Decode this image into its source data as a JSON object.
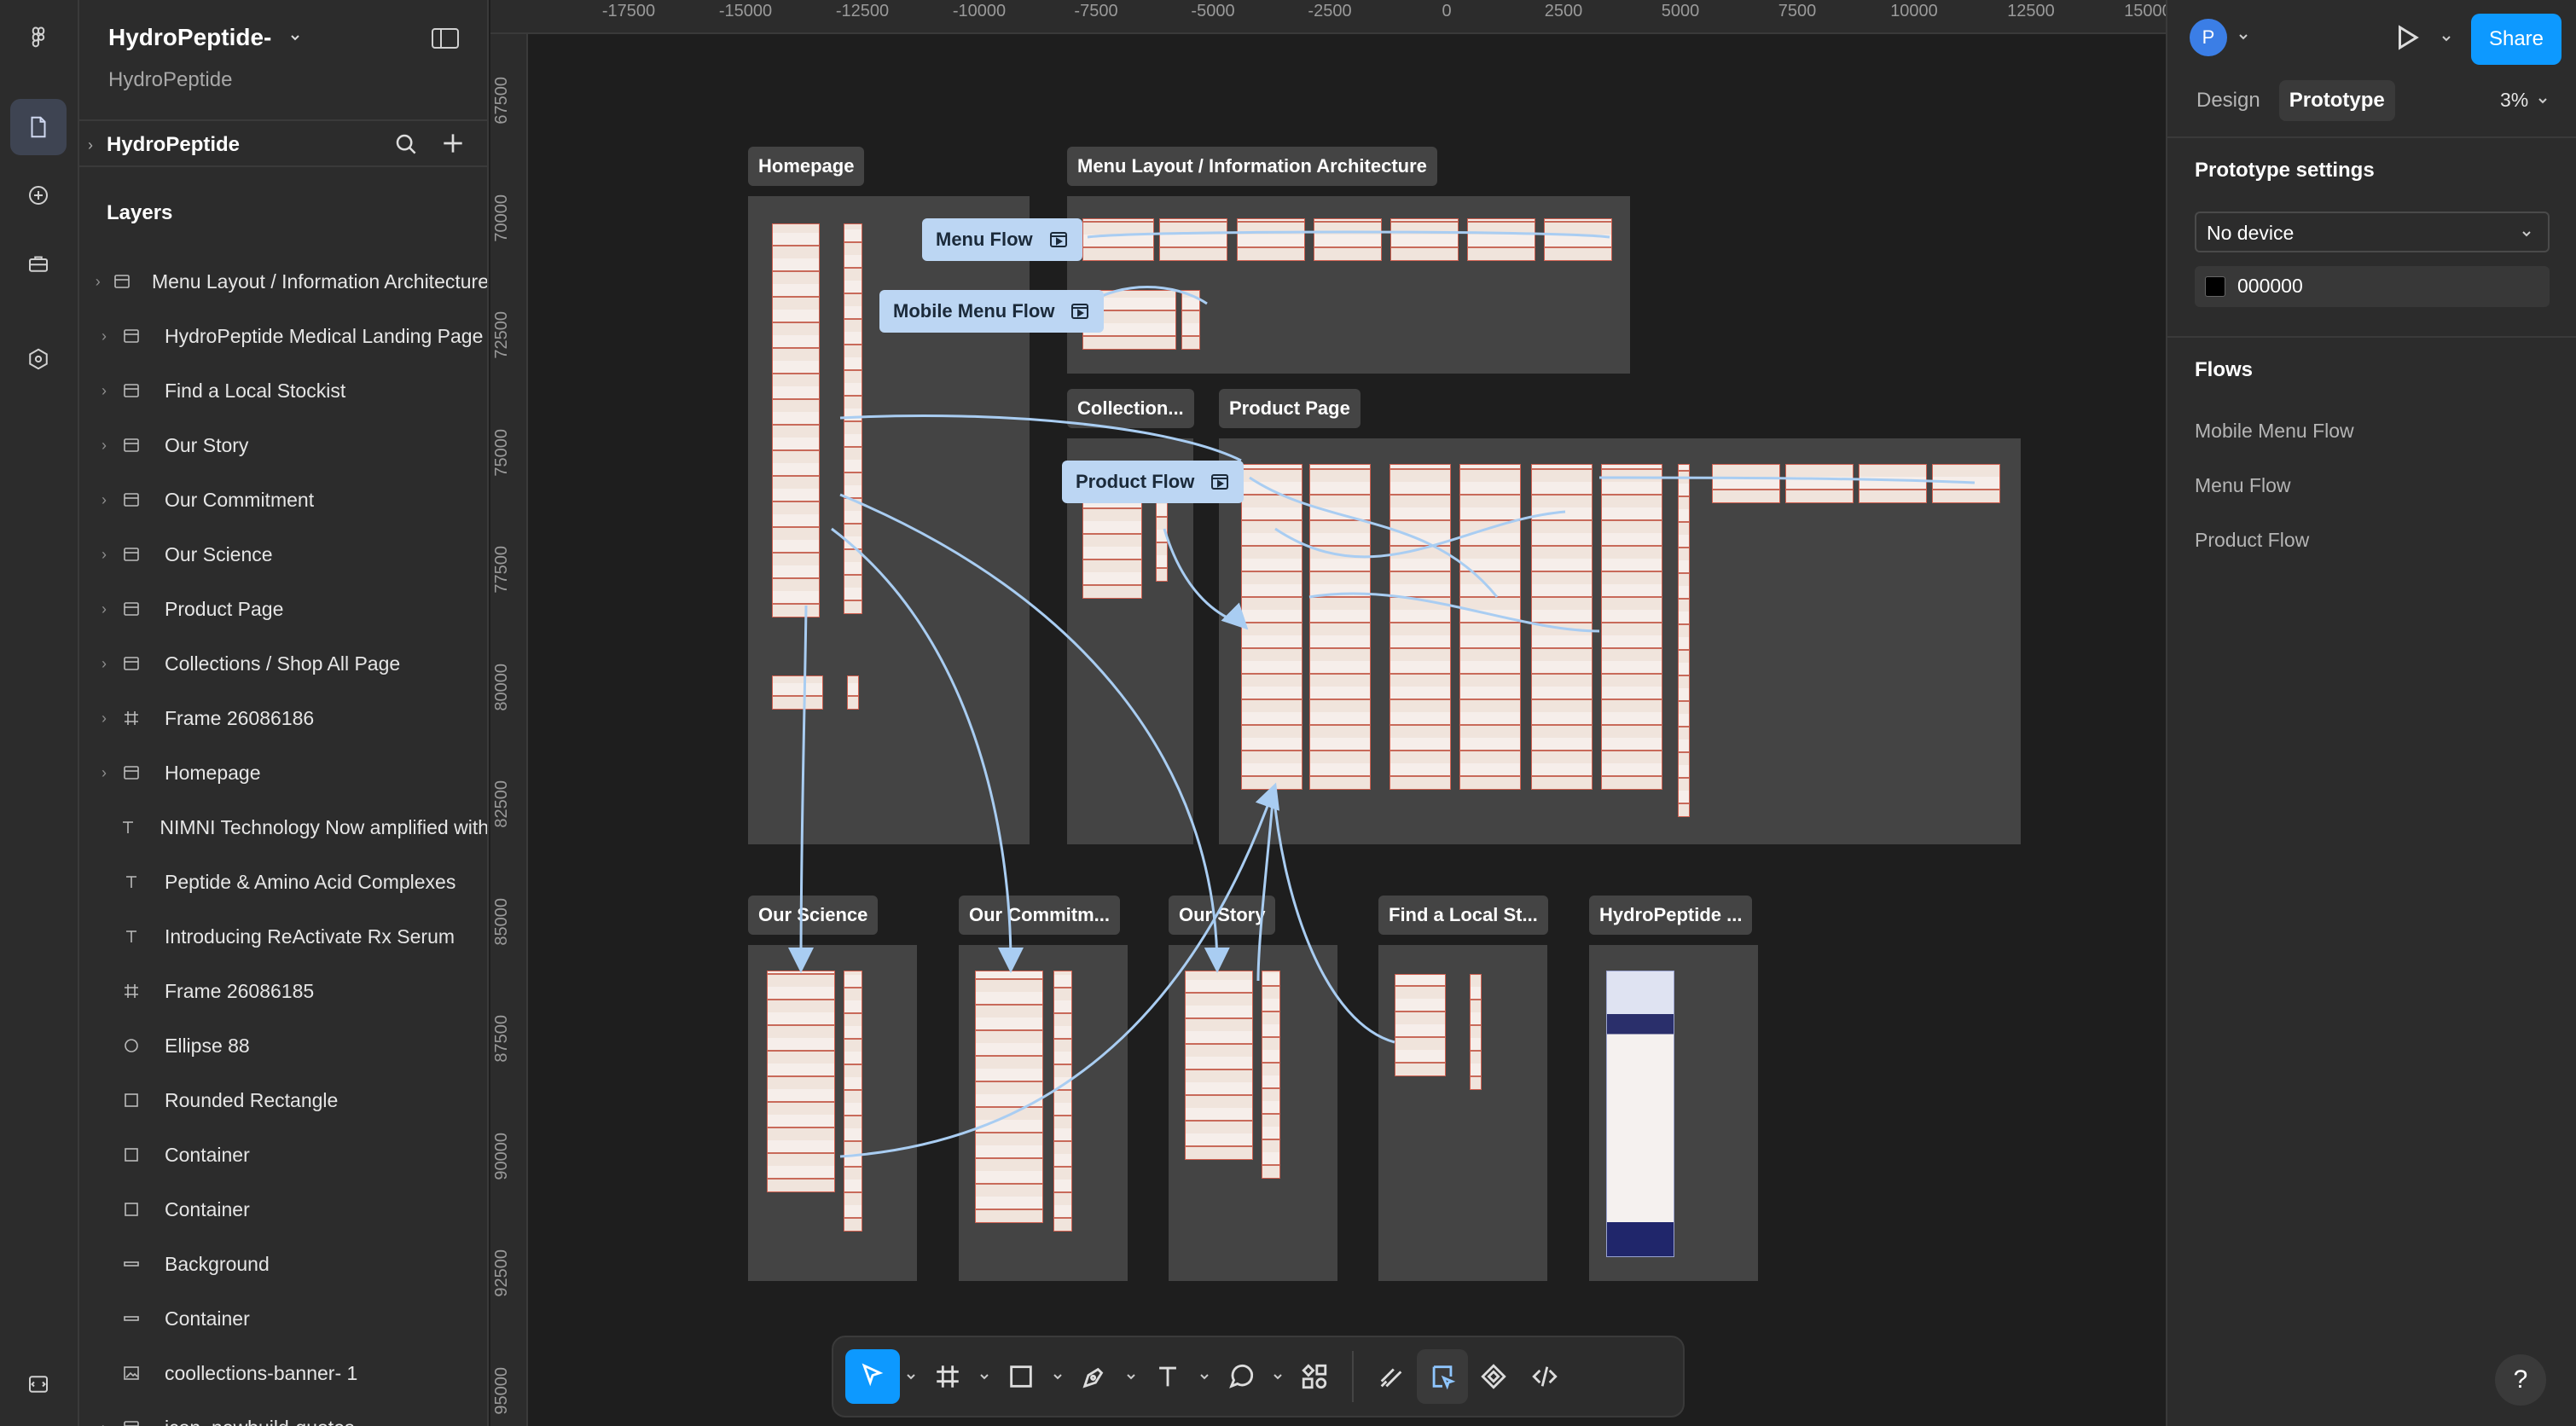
{
  "file": {
    "title": "HydroPeptide-",
    "subtitle": "HydroPeptide"
  },
  "pages": {
    "current": "HydroPeptide"
  },
  "layers": {
    "title": "Layers",
    "items": [
      {
        "label": "Menu Layout / Information Architecture",
        "kind": "section",
        "expandable": true
      },
      {
        "label": "HydroPeptide Medical Landing Page",
        "kind": "section",
        "expandable": true
      },
      {
        "label": "Find a Local Stockist",
        "kind": "section",
        "expandable": true
      },
      {
        "label": "Our Story",
        "kind": "section",
        "expandable": true
      },
      {
        "label": "Our Commitment",
        "kind": "section",
        "expandable": true
      },
      {
        "label": "Our Science",
        "kind": "section",
        "expandable": true
      },
      {
        "label": "Product Page",
        "kind": "section",
        "expandable": true
      },
      {
        "label": "Collections / Shop All Page",
        "kind": "section",
        "expandable": true
      },
      {
        "label": "Frame 26086186",
        "kind": "frame",
        "expandable": true
      },
      {
        "label": "Homepage",
        "kind": "section",
        "expandable": true
      },
      {
        "label": "NIMNI Technology Now amplified with",
        "kind": "text",
        "expandable": false
      },
      {
        "label": "Peptide & Amino Acid Complexes",
        "kind": "text",
        "expandable": false
      },
      {
        "label": "Introducing ReActivate Rx Serum",
        "kind": "text",
        "expandable": false
      },
      {
        "label": "Frame 26086185",
        "kind": "frame",
        "expandable": false
      },
      {
        "label": "Ellipse 88",
        "kind": "ellipse",
        "expandable": false
      },
      {
        "label": "Rounded Rectangle",
        "kind": "rect",
        "expandable": false
      },
      {
        "label": "Container",
        "kind": "rect",
        "expandable": false
      },
      {
        "label": "Container",
        "kind": "rect",
        "expandable": false
      },
      {
        "label": "Background",
        "kind": "line",
        "expandable": false
      },
      {
        "label": "Container",
        "kind": "line",
        "expandable": false
      },
      {
        "label": "coollections-banner- 1",
        "kind": "image",
        "expandable": false
      },
      {
        "label": "icon_newbuild-quotes",
        "kind": "section",
        "expandable": true
      }
    ]
  },
  "canvas": {
    "ruler_x": [
      "-17500",
      "-15000",
      "-12500",
      "-10000",
      "-7500",
      "-5000",
      "-2500",
      "0",
      "2500",
      "5000",
      "7500",
      "10000",
      "12500",
      "15000"
    ],
    "ruler_y": [
      "67500",
      "70000",
      "72500",
      "75000",
      "77500",
      "80000",
      "82500",
      "85000",
      "87500",
      "90000",
      "92500",
      "95000"
    ],
    "sections": {
      "homepage": "Homepage",
      "menu_layout": "Menu Layout / Information Architecture",
      "collections": "Collection...",
      "product_page": "Product Page",
      "our_science": "Our Science",
      "our_commitment": "Our Commitm...",
      "our_story": "Our Story",
      "find_stockist": "Find a Local St...",
      "hydropeptide": "HydroPeptide ..."
    },
    "flows": {
      "menu": "Menu Flow",
      "mobile_menu": "Mobile Menu Flow",
      "product": "Product Flow"
    }
  },
  "right_panel": {
    "avatar_initial": "P",
    "share_label": "Share",
    "tabs": [
      "Design",
      "Prototype"
    ],
    "active_tab": "Prototype",
    "zoom": "3%",
    "prototype_settings_title": "Prototype settings",
    "device": "No device",
    "background_hex": "000000",
    "flows_title": "Flows",
    "flows": [
      "Mobile Menu Flow",
      "Menu Flow",
      "Product Flow"
    ]
  },
  "colors": {
    "accent": "#0d99ff",
    "flow_chip": "#bcd6f3",
    "connector": "#a9cdf2",
    "section_fill": "#444444"
  },
  "help_label": "?"
}
